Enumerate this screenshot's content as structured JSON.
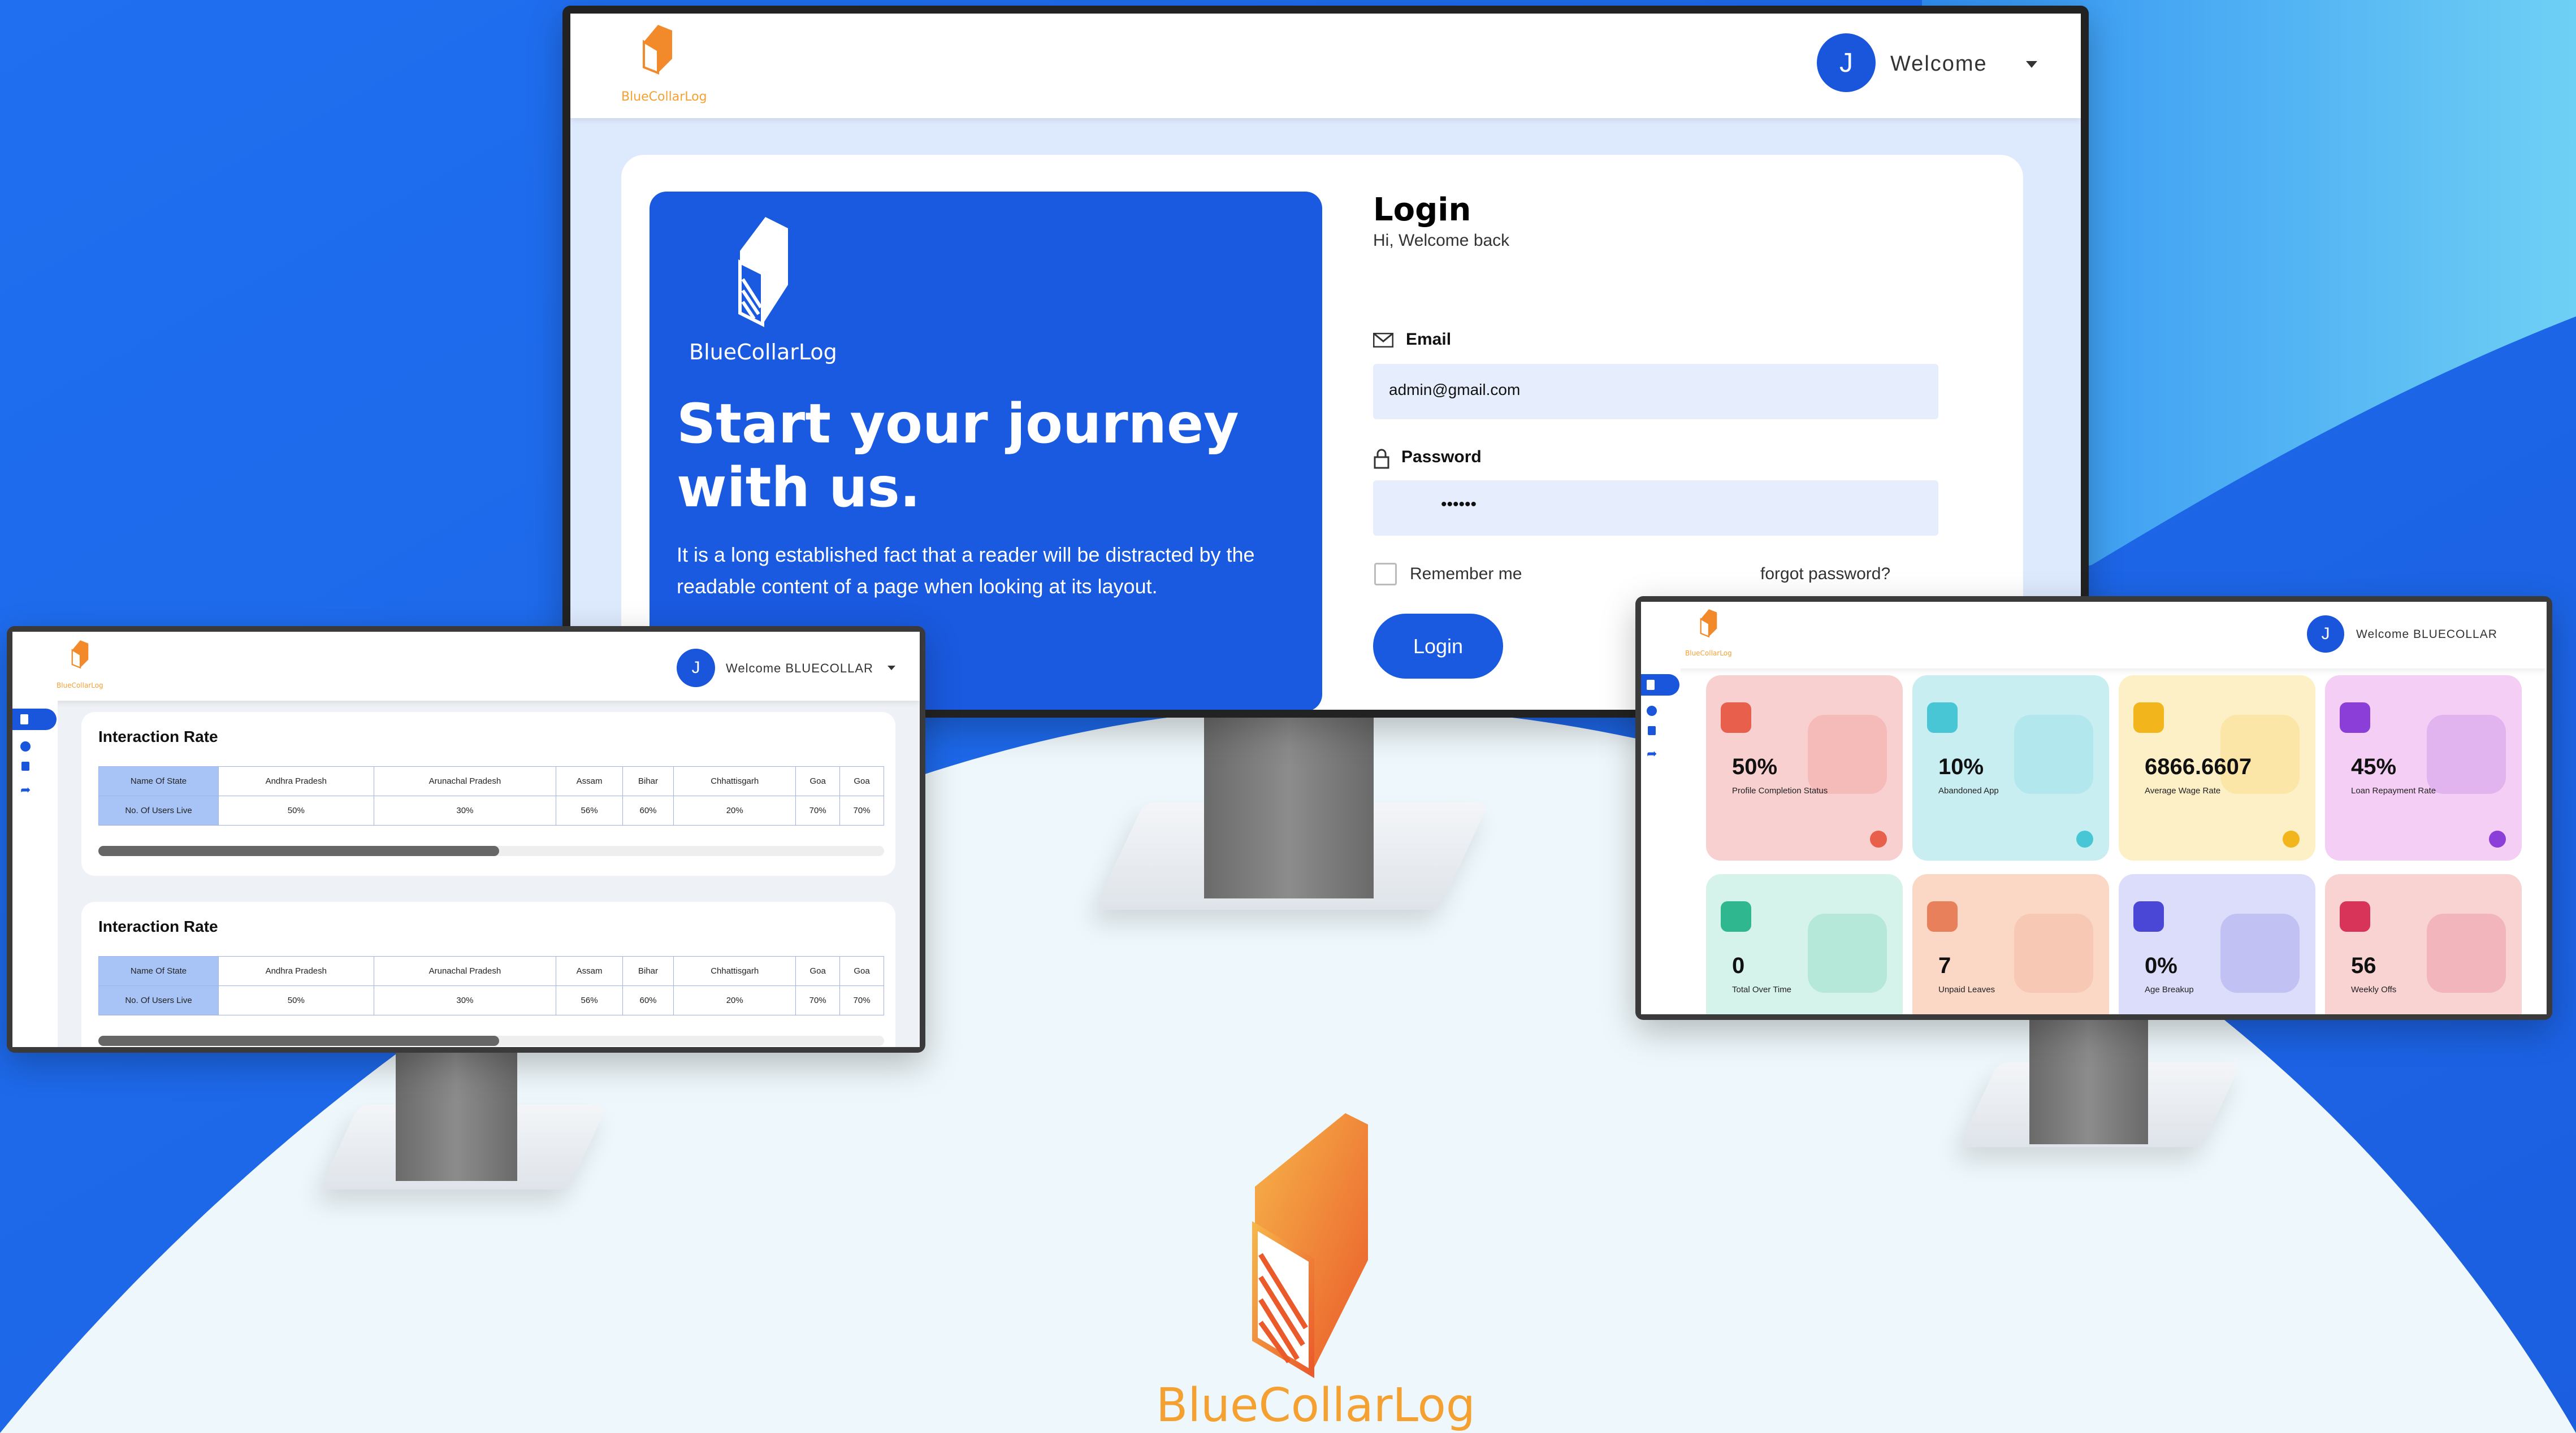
{
  "colors": {
    "brand_blue": "#1a56db",
    "accent_orange": "#f4a132",
    "bg_blue": "#1d6ff0",
    "bg_light": "#eef7fb"
  },
  "brand": {
    "name": "BlueCollarLog",
    "icon": "notebook-logo-icon"
  },
  "main_screen": {
    "header": {
      "avatar_letter": "J",
      "welcome": "Welcome"
    },
    "hero": {
      "logo_text": "BlueCollarLog",
      "heading_line1": "Start your journey",
      "heading_line2": "with us.",
      "body": "It is a long established fact that a reader will be distracted by the readable content of a page when looking at its layout."
    },
    "login": {
      "title": "Login",
      "subtitle": "Hi, Welcome back",
      "email_label": "Email",
      "email_value": "admin@gmail.com",
      "password_label": "Password",
      "password_value": "••••••",
      "remember_label": "Remember me",
      "forgot_label": "forgot password?",
      "login_button": "Login"
    }
  },
  "left_screen": {
    "header": {
      "logo_text": "BlueCollarLog",
      "avatar_letter": "J",
      "welcome": "Welcome BLUECOLLAR"
    },
    "sections": [
      {
        "title": "Interaction Rate",
        "row_headers": [
          "Name Of State",
          "No. Of Users Live"
        ],
        "states": [
          "Andhra Pradesh",
          "Arunachal Pradesh",
          "Assam",
          "Bihar",
          "Chhattisgarh",
          "Goa",
          "Goa"
        ],
        "values": [
          "50%",
          "30%",
          "56%",
          "60%",
          "20%",
          "70%",
          "70%"
        ],
        "scroll_progress": 0.51
      },
      {
        "title": "Interaction Rate",
        "row_headers": [
          "Name Of State",
          "No. Of Users Live"
        ],
        "states": [
          "Andhra Pradesh",
          "Arunachal Pradesh",
          "Assam",
          "Bihar",
          "Chhattisgarh",
          "Goa",
          "Goa"
        ],
        "values": [
          "50%",
          "30%",
          "56%",
          "60%",
          "20%",
          "70%",
          "70%"
        ],
        "scroll_progress": 0.51
      }
    ]
  },
  "right_screen": {
    "header": {
      "logo_text": "BlueCollarLog",
      "avatar_letter": "J",
      "welcome": "Welcome BLUECOLLAR"
    },
    "tiles": [
      {
        "value": "50%",
        "label": "Profile Completion Status",
        "bg": "#f8d0d0",
        "icon_color": "#e8604c"
      },
      {
        "value": "10%",
        "label": "Abandoned App",
        "bg": "#c9eef2",
        "icon_color": "#48c6d6"
      },
      {
        "value": "6866.6607",
        "label": "Average Wage Rate",
        "bg": "#fdf0c6",
        "icon_color": "#f2b51c"
      },
      {
        "value": "45%",
        "label": "Loan Repayment Rate",
        "bg": "#f4cef5",
        "icon_color": "#8c3fd8"
      },
      {
        "value": "0",
        "label": "Total Over Time",
        "bg": "#d5f3ea",
        "icon_color": "#2fb890"
      },
      {
        "value": "7",
        "label": "Unpaid Leaves",
        "bg": "#fbd8c6",
        "icon_color": "#e8805c"
      },
      {
        "value": "0%",
        "label": "Age Breakup",
        "bg": "#dcdcfb",
        "icon_color": "#4a46d6"
      },
      {
        "value": "56",
        "label": "Weekly Offs",
        "bg": "#f9d2d2",
        "icon_color": "#d8345a"
      }
    ]
  },
  "bottom_logo": {
    "text": "BlueCollarLog"
  }
}
